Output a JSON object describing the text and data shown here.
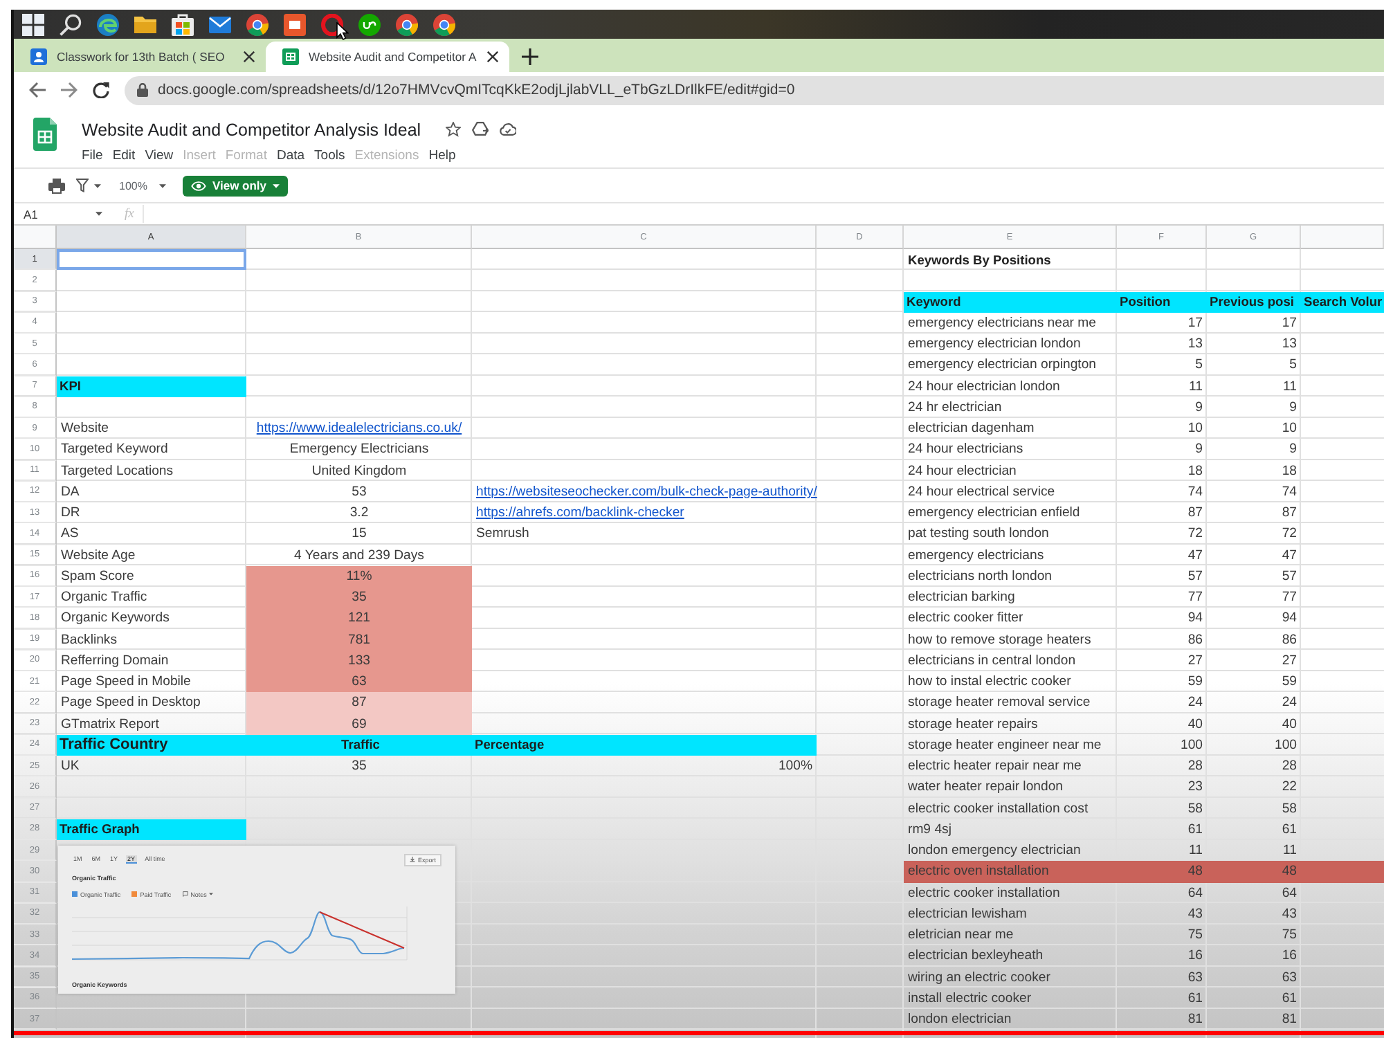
{
  "browser_tabs": [
    {
      "title": "Classwork for 13th Batch ( SEO",
      "selected": false
    },
    {
      "title": "Website Audit and Competitor A",
      "selected": true
    }
  ],
  "address_bar": {
    "url": "docs.google.com/spreadsheets/d/12o7HMVcvQmITcqKkE2odjLjlabVLL_eTbGzLDrIlkFE/edit#gid=0"
  },
  "document": {
    "title": "Website Audit and Competitor Analysis Ideal",
    "menus": [
      {
        "label": "File",
        "disabled": false
      },
      {
        "label": "Edit",
        "disabled": false
      },
      {
        "label": "View",
        "disabled": false
      },
      {
        "label": "Insert",
        "disabled": true
      },
      {
        "label": "Format",
        "disabled": true
      },
      {
        "label": "Data",
        "disabled": false
      },
      {
        "label": "Tools",
        "disabled": false
      },
      {
        "label": "Extensions",
        "disabled": true
      },
      {
        "label": "Help",
        "disabled": false
      }
    ]
  },
  "toolbar": {
    "zoom": "100%",
    "mode_button": "View only"
  },
  "formula_bar": {
    "name_box": "A1",
    "function_label": "fx"
  },
  "sheet": {
    "columns": [
      {
        "label": "A",
        "selected": true
      },
      {
        "label": "B",
        "selected": false
      },
      {
        "label": "C",
        "selected": false
      },
      {
        "label": "D",
        "selected": false
      },
      {
        "label": "E",
        "selected": false
      },
      {
        "label": "F",
        "selected": false
      },
      {
        "label": "G",
        "selected": false
      },
      {
        "selected": false
      }
    ],
    "rows": [
      {
        "number": "1",
        "selected": true,
        "e": {
          "text": "Keywords By Positions",
          "kind": "title"
        }
      },
      {
        "number": "2",
        "selected": false
      },
      {
        "number": "3",
        "selected": false,
        "e": {
          "text": "Keyword",
          "kind": "header"
        },
        "f": {
          "text": "Position",
          "kind": "header"
        },
        "g": {
          "text": "Previous posi",
          "kind": "header"
        },
        "h": {
          "text": "Search Volur",
          "kind": "header"
        }
      },
      {
        "number": "4",
        "selected": false,
        "e": {
          "text": "emergency electricians near me",
          "kind": "text"
        },
        "f": {
          "text": "17",
          "kind": "number"
        },
        "g": {
          "text": "17",
          "kind": "number"
        }
      },
      {
        "number": "5",
        "selected": false,
        "e": {
          "text": "emergency electrician london",
          "kind": "text"
        },
        "f": {
          "text": "13",
          "kind": "number"
        },
        "g": {
          "text": "13",
          "kind": "number"
        }
      },
      {
        "number": "6",
        "selected": false,
        "e": {
          "text": "emergency electrician orpington",
          "kind": "text"
        },
        "f": {
          "text": "5",
          "kind": "number"
        },
        "g": {
          "text": "5",
          "kind": "number"
        }
      },
      {
        "number": "7",
        "selected": false,
        "a": {
          "text": "KPI",
          "kind": "header"
        },
        "e": {
          "text": "24 hour electrician london",
          "kind": "text"
        },
        "f": {
          "text": "11",
          "kind": "number"
        },
        "g": {
          "text": "11",
          "kind": "number"
        }
      },
      {
        "number": "8",
        "selected": false,
        "e": {
          "text": "24 hr electrician",
          "kind": "text"
        },
        "f": {
          "text": "9",
          "kind": "number"
        },
        "g": {
          "text": "9",
          "kind": "number"
        }
      },
      {
        "number": "9",
        "selected": false,
        "a": {
          "text": "Website",
          "kind": "text"
        },
        "b": {
          "text": "https://www.idealelectricians.co.uk/",
          "kind": "link"
        },
        "e": {
          "text": "electrician dagenham",
          "kind": "text"
        },
        "f": {
          "text": "10",
          "kind": "number"
        },
        "g": {
          "text": "10",
          "kind": "number"
        }
      },
      {
        "number": "10",
        "selected": false,
        "a": {
          "text": "Targeted Keyword",
          "kind": "text"
        },
        "b": {
          "text": "Emergency Electricians",
          "kind": "text"
        },
        "e": {
          "text": "24 hour electricians",
          "kind": "text"
        },
        "f": {
          "text": "9",
          "kind": "number"
        },
        "g": {
          "text": "9",
          "kind": "number"
        }
      },
      {
        "number": "11",
        "selected": false,
        "a": {
          "text": "Targeted Locations",
          "kind": "text"
        },
        "b": {
          "text": "United Kingdom",
          "kind": "text"
        },
        "e": {
          "text": "24 hour electrician",
          "kind": "text"
        },
        "f": {
          "text": "18",
          "kind": "number"
        },
        "g": {
          "text": "18",
          "kind": "number"
        }
      },
      {
        "number": "12",
        "selected": false,
        "a": {
          "text": "DA",
          "kind": "text"
        },
        "b": {
          "text": "53",
          "kind": "text"
        },
        "c": {
          "text": "https://websiteseochecker.com/bulk-check-page-authority/",
          "kind": "link"
        },
        "e": {
          "text": "24 hour electrical service",
          "kind": "text"
        },
        "f": {
          "text": "74",
          "kind": "number"
        },
        "g": {
          "text": "74",
          "kind": "number"
        }
      },
      {
        "number": "13",
        "selected": false,
        "a": {
          "text": "DR",
          "kind": "text"
        },
        "b": {
          "text": "3.2",
          "kind": "text"
        },
        "c": {
          "text": "https://ahrefs.com/backlink-checker",
          "kind": "link"
        },
        "e": {
          "text": "emergency electrician enfield",
          "kind": "text"
        },
        "f": {
          "text": "87",
          "kind": "number"
        },
        "g": {
          "text": "87",
          "kind": "number"
        }
      },
      {
        "number": "14",
        "selected": false,
        "a": {
          "text": "AS",
          "kind": "text"
        },
        "b": {
          "text": "15",
          "kind": "text"
        },
        "c": {
          "text": "Semrush",
          "kind": "text"
        },
        "e": {
          "text": "pat testing south london",
          "kind": "text"
        },
        "f": {
          "text": "72",
          "kind": "number"
        },
        "g": {
          "text": "72",
          "kind": "number"
        }
      },
      {
        "number": "15",
        "selected": false,
        "a": {
          "text": "Website Age",
          "kind": "text"
        },
        "b": {
          "text": "4 Years and 239 Days",
          "kind": "text"
        },
        "e": {
          "text": "emergency electricians",
          "kind": "text"
        },
        "f": {
          "text": "47",
          "kind": "number"
        },
        "g": {
          "text": "47",
          "kind": "number"
        }
      },
      {
        "number": "16",
        "selected": false,
        "a": {
          "text": "Spam Score",
          "kind": "text"
        },
        "b": {
          "text": "11%",
          "kind": "text",
          "color": "#e6978e"
        },
        "e": {
          "text": "electricians north london",
          "kind": "text"
        },
        "f": {
          "text": "57",
          "kind": "number"
        },
        "g": {
          "text": "57",
          "kind": "number"
        }
      },
      {
        "number": "17",
        "selected": false,
        "a": {
          "text": "Organic Traffic",
          "kind": "text"
        },
        "b": {
          "text": "35",
          "kind": "text",
          "color": "#e6978e"
        },
        "e": {
          "text": "electrician barking",
          "kind": "text"
        },
        "f": {
          "text": "77",
          "kind": "number"
        },
        "g": {
          "text": "77",
          "kind": "number"
        }
      },
      {
        "number": "18",
        "selected": false,
        "a": {
          "text": "Organic Keywords",
          "kind": "text"
        },
        "b": {
          "text": "121",
          "kind": "text",
          "color": "#e6978e"
        },
        "e": {
          "text": "electric cooker fitter",
          "kind": "text"
        },
        "f": {
          "text": "94",
          "kind": "number"
        },
        "g": {
          "text": "94",
          "kind": "number"
        }
      },
      {
        "number": "19",
        "selected": false,
        "a": {
          "text": "Backlinks",
          "kind": "text"
        },
        "b": {
          "text": "781",
          "kind": "text",
          "color": "#e6978e"
        },
        "e": {
          "text": "how to remove storage heaters",
          "kind": "text"
        },
        "f": {
          "text": "86",
          "kind": "number"
        },
        "g": {
          "text": "86",
          "kind": "number"
        }
      },
      {
        "number": "20",
        "selected": false,
        "a": {
          "text": "Refferring Domain",
          "kind": "text"
        },
        "b": {
          "text": "133",
          "kind": "text",
          "color": "#e6978e"
        },
        "e": {
          "text": "electricians in central london",
          "kind": "text"
        },
        "f": {
          "text": "27",
          "kind": "number"
        },
        "g": {
          "text": "27",
          "kind": "number"
        }
      },
      {
        "number": "21",
        "selected": false,
        "a": {
          "text": "Page Speed in Mobile",
          "kind": "text"
        },
        "b": {
          "text": "63",
          "kind": "text",
          "color": "#e6978e"
        },
        "e": {
          "text": "how to instal electric cooker",
          "kind": "text"
        },
        "f": {
          "text": "59",
          "kind": "number"
        },
        "g": {
          "text": "59",
          "kind": "number"
        }
      },
      {
        "number": "22",
        "selected": false,
        "a": {
          "text": "Page Speed in Desktop",
          "kind": "text"
        },
        "b": {
          "text": "87",
          "kind": "text",
          "color": "#f3c8c4"
        },
        "e": {
          "text": "storage heater removal service",
          "kind": "text"
        },
        "f": {
          "text": "24",
          "kind": "number"
        },
        "g": {
          "text": "24",
          "kind": "number"
        }
      },
      {
        "number": "23",
        "selected": false,
        "a": {
          "text": "GTmatrix Report",
          "kind": "text"
        },
        "b": {
          "text": "69",
          "kind": "text",
          "color": "#f3c8c4"
        },
        "e": {
          "text": "storage heater repairs",
          "kind": "text"
        },
        "f": {
          "text": "40",
          "kind": "number"
        },
        "g": {
          "text": "40",
          "kind": "number"
        }
      },
      {
        "number": "24",
        "selected": false,
        "a": {
          "text": "Traffic Country",
          "kind": "big_header"
        },
        "b": {
          "text": "Traffic",
          "kind": "header"
        },
        "c": {
          "text": "Percentage",
          "kind": "header"
        },
        "e": {
          "text": "storage heater engineer near me",
          "kind": "text"
        },
        "f": {
          "text": "100",
          "kind": "number"
        },
        "g": {
          "text": "100",
          "kind": "number"
        }
      },
      {
        "number": "25",
        "selected": false,
        "a": {
          "text": "UK",
          "kind": "text"
        },
        "b": {
          "text": "35",
          "kind": "text"
        },
        "c": {
          "text": "100%",
          "kind": "number"
        },
        "e": {
          "text": "electric heater repair near me",
          "kind": "text"
        },
        "f": {
          "text": "28",
          "kind": "number"
        },
        "g": {
          "text": "28",
          "kind": "number"
        }
      },
      {
        "number": "26",
        "selected": false,
        "e": {
          "text": "water heater repair london",
          "kind": "text"
        },
        "f": {
          "text": "23",
          "kind": "number"
        },
        "g": {
          "text": "22",
          "kind": "number"
        }
      },
      {
        "number": "27",
        "selected": false,
        "e": {
          "text": "electric cooker installation cost",
          "kind": "text"
        },
        "f": {
          "text": "58",
          "kind": "number"
        },
        "g": {
          "text": "58",
          "kind": "number"
        }
      },
      {
        "number": "28",
        "selected": false,
        "a": {
          "text": "Traffic Graph",
          "kind": "header"
        },
        "e": {
          "text": "rm9 4sj",
          "kind": "text"
        },
        "f": {
          "text": "61",
          "kind": "number"
        },
        "g": {
          "text": "61",
          "kind": "number"
        }
      },
      {
        "number": "29",
        "selected": false,
        "e": {
          "text": "london emergency electrician",
          "kind": "text"
        },
        "f": {
          "text": "11",
          "kind": "number"
        },
        "g": {
          "text": "11",
          "kind": "number"
        }
      },
      {
        "number": "30",
        "selected": false,
        "e": {
          "text": "electric oven installation",
          "kind": "text",
          "color": "#c9625a"
        },
        "f": {
          "text": "48",
          "kind": "number",
          "color": "#c9625a"
        },
        "g": {
          "text": "48",
          "kind": "number",
          "color": "#c9625a"
        },
        "h": {
          "kind": "text",
          "color": "#c9625a"
        }
      },
      {
        "number": "31",
        "selected": false,
        "e": {
          "text": "electric cooker installation",
          "kind": "text"
        },
        "f": {
          "text": "64",
          "kind": "number"
        },
        "g": {
          "text": "64",
          "kind": "number"
        }
      },
      {
        "number": "32",
        "selected": false,
        "e": {
          "text": "electrician lewisham",
          "kind": "text"
        },
        "f": {
          "text": "43",
          "kind": "number"
        },
        "g": {
          "text": "43",
          "kind": "number"
        }
      },
      {
        "number": "33",
        "selected": false,
        "e": {
          "text": "eletrician near me",
          "kind": "text"
        },
        "f": {
          "text": "75",
          "kind": "number"
        },
        "g": {
          "text": "75",
          "kind": "number"
        }
      },
      {
        "number": "34",
        "selected": false,
        "e": {
          "text": "electrician bexleyheath",
          "kind": "text"
        },
        "f": {
          "text": "16",
          "kind": "number"
        },
        "g": {
          "text": "16",
          "kind": "number"
        }
      },
      {
        "number": "35",
        "selected": false,
        "e": {
          "text": "wiring an electric cooker",
          "kind": "text"
        },
        "f": {
          "text": "63",
          "kind": "number"
        },
        "g": {
          "text": "63",
          "kind": "number"
        }
      },
      {
        "number": "36",
        "selected": false,
        "e": {
          "text": "install electric cooker",
          "kind": "text"
        },
        "f": {
          "text": "61",
          "kind": "number"
        },
        "g": {
          "text": "61",
          "kind": "number"
        }
      },
      {
        "number": "37",
        "selected": false,
        "e": {
          "text": "london electrician",
          "kind": "text"
        },
        "f": {
          "text": "81",
          "kind": "number"
        },
        "g": {
          "text": "81",
          "kind": "number"
        }
      }
    ],
    "image": {
      "range_tabs": [
        {
          "label": "1M",
          "selected": false
        },
        {
          "label": "6M",
          "selected": false
        },
        {
          "label": "1Y",
          "selected": false
        },
        {
          "label": "2Y",
          "selected": true
        },
        {
          "label": "All time",
          "selected": false
        }
      ],
      "export": "Export",
      "title": "Organic Traffic",
      "legend": [
        {
          "label": "Organic Traffic",
          "kind": "series",
          "color": "#4a90d9"
        },
        {
          "label": "Paid Traffic",
          "kind": "series",
          "color": "#f08a3c"
        },
        {
          "label": "Notes",
          "kind": "notes"
        }
      ],
      "footer": "Organic Keywords"
    }
  }
}
